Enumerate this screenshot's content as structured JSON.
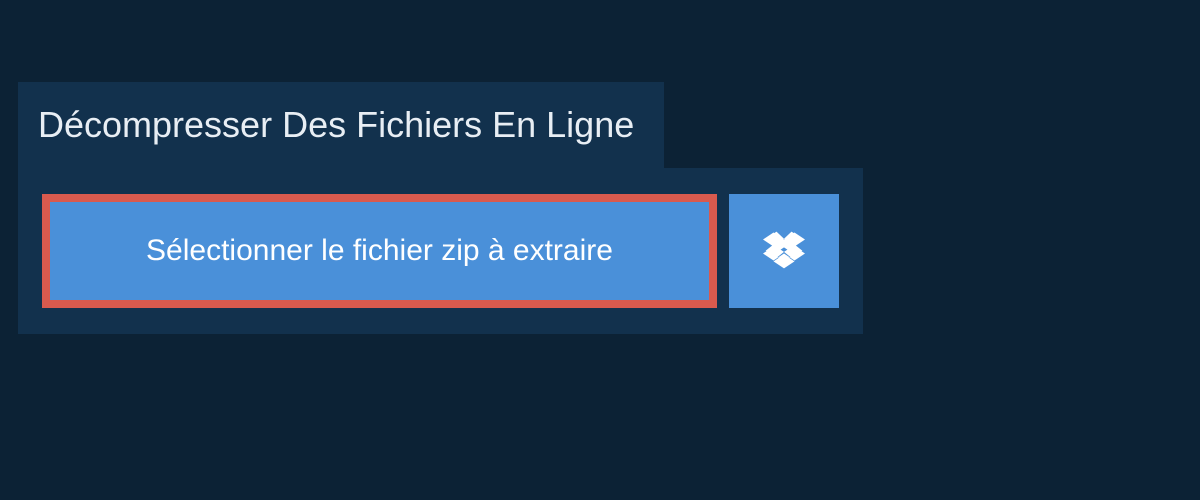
{
  "header": {
    "title": "Décompresser Des Fichiers En Ligne"
  },
  "actions": {
    "select_file_label": "Sélectionner le fichier zip à extraire",
    "dropbox_icon": "dropbox"
  },
  "colors": {
    "background": "#0c2235",
    "panel": "#12314d",
    "button": "#4a90d9",
    "highlight_border": "#d95a4e"
  }
}
